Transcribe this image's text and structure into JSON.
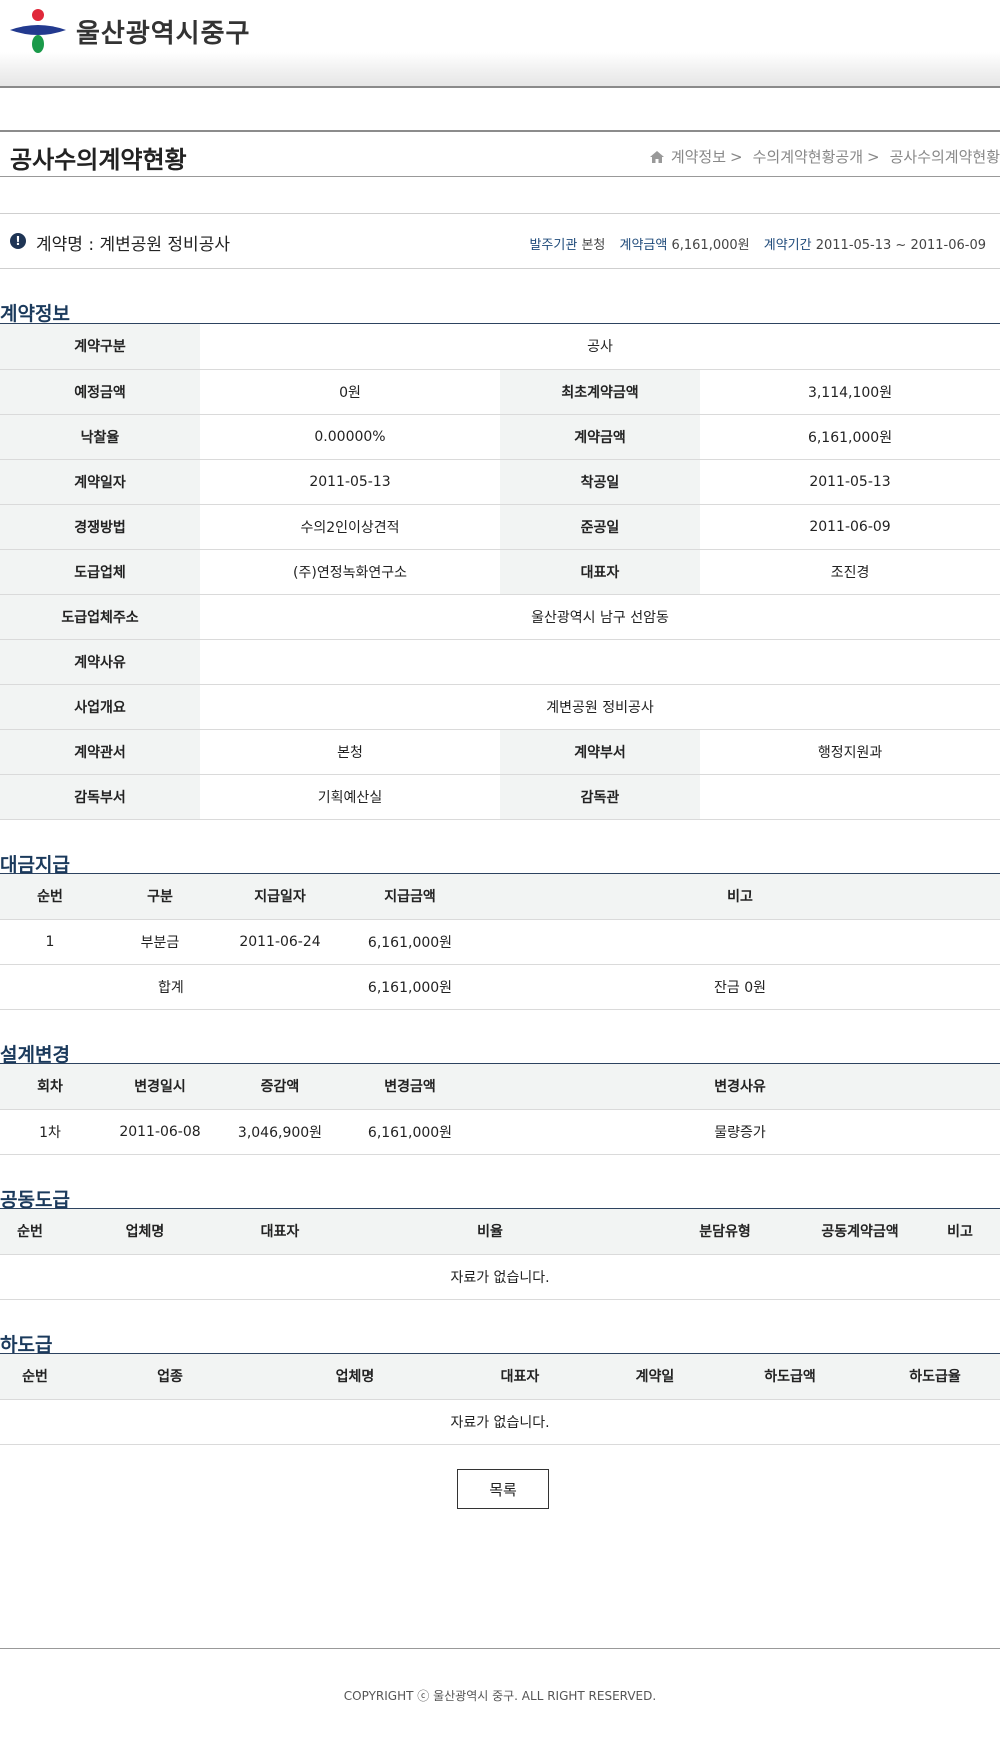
{
  "header": {
    "logo_text": "울산광역시중구"
  },
  "page": {
    "title": "공사수의계약현황",
    "breadcrumb": [
      "계약정보",
      "수의계약현황공개",
      "공사수의계약현황"
    ],
    "breadcrumb_sep": ">"
  },
  "summary": {
    "contract_name": "계약명 : 계변공원 정비공사",
    "org_label": "발주기관",
    "org_value": "본청",
    "amount_label": "계약금액",
    "amount_value": "6,161,000원",
    "period_label": "계약기간",
    "period_value": "2011-05-13 ~ 2011-06-09"
  },
  "contract_info": {
    "title": "계약정보",
    "type_label": "계약구분",
    "type_value": "공사",
    "rows": [
      {
        "l1": "예정금액",
        "v1": "0원",
        "l2": "최초계약금액",
        "v2": "3,114,100원"
      },
      {
        "l1": "낙찰율",
        "v1": "0.00000%",
        "l2": "계약금액",
        "v2": "6,161,000원"
      },
      {
        "l1": "계약일자",
        "v1": "2011-05-13",
        "l2": "착공일",
        "v2": "2011-05-13"
      },
      {
        "l1": "경쟁방법",
        "v1": "수의2인이상견적",
        "l2": "준공일",
        "v2": "2011-06-09"
      },
      {
        "l1": "도급업체",
        "v1": "(주)연정녹화연구소",
        "l2": "대표자",
        "v2": "조진경"
      }
    ],
    "address_label": "도급업체주소",
    "address_value": "울산광역시 남구 선암동",
    "reason_label": "계약사유",
    "reason_value": "",
    "overview_label": "사업개요",
    "overview_value": "계변공원 정비공사",
    "rows2": [
      {
        "l1": "계약관서",
        "v1": "본청",
        "l2": "계약부서",
        "v2": "행정지원과"
      },
      {
        "l1": "감독부서",
        "v1": "기획예산실",
        "l2": "감독관",
        "v2": ""
      }
    ]
  },
  "payment": {
    "title": "대금지급",
    "headers": [
      "순번",
      "구분",
      "지급일자",
      "지급금액",
      "비고"
    ],
    "rows": [
      [
        "1",
        "부분금",
        "2011-06-24",
        "6,161,000원",
        ""
      ]
    ],
    "total": {
      "label": "합계",
      "amount": "6,161,000원",
      "note": "잔금 0원"
    }
  },
  "design_change": {
    "title": "설계변경",
    "headers": [
      "회차",
      "변경일시",
      "증감액",
      "변경금액",
      "변경사유"
    ],
    "rows": [
      [
        "1차",
        "2011-06-08",
        "3,046,900원",
        "6,161,000원",
        "물량증가"
      ]
    ]
  },
  "joint": {
    "title": "공동도급",
    "headers": [
      "순번",
      "업체명",
      "대표자",
      "비율",
      "분담유형",
      "공동계약금액",
      "비고"
    ],
    "empty": "자료가 없습니다."
  },
  "subcontract": {
    "title": "하도급",
    "headers": [
      "순번",
      "업종",
      "업체명",
      "대표자",
      "계약일",
      "하도급액",
      "하도급율"
    ],
    "empty": "자료가 없습니다."
  },
  "buttons": {
    "list": "목록"
  },
  "footer": {
    "copyright": "COPYRIGHT ⓒ 울산광역시 중구. ALL RIGHT RESERVED."
  },
  "colors": {
    "section_title": "#1b3a5c",
    "header_bg": "#f2f4f3",
    "logo_red": "#e0283a",
    "logo_blue": "#233a8f",
    "logo_green": "#1a9a4a"
  }
}
